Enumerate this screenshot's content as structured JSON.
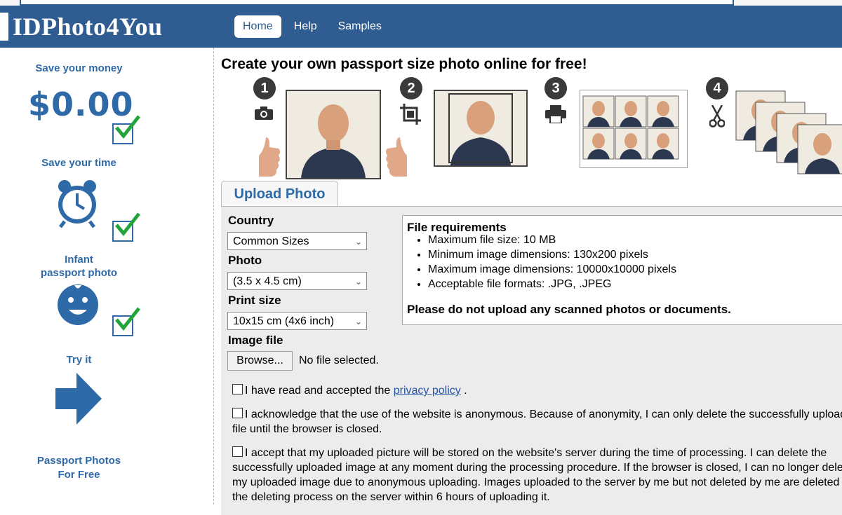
{
  "brand": {
    "logo": "IDPhoto4You"
  },
  "nav": {
    "items": [
      "Home",
      "Help",
      "Samples"
    ]
  },
  "sidebar": {
    "save_money": "Save your money",
    "price": "$0.00",
    "save_time": "Save your time",
    "infant": "Infant\npassport photo",
    "try_it": "Try it",
    "footer": "Passport Photos\nFor Free"
  },
  "main": {
    "headline": "Create your own passport size photo online for free!",
    "steps": [
      "1",
      "2",
      "3",
      "4"
    ],
    "tab": "Upload Photo"
  },
  "form": {
    "country_label": "Country",
    "country_value": "Common Sizes",
    "photo_label": "Photo",
    "photo_value": "(3.5 x 4.5 cm)",
    "print_label": "Print size",
    "print_value": "10x15 cm (4x6 inch)",
    "image_label": "Image file",
    "browse": "Browse...",
    "no_file": "No file selected."
  },
  "requirements": {
    "title": "File requirements",
    "items": [
      "Maximum file size: 10 MB",
      "Minimum image dimensions: 130x200 pixels",
      "Maximum image dimensions: 10000x10000 pixels",
      "Acceptable file formats: .JPG, .JPEG"
    ],
    "warning": "Please do not upload any scanned photos or documents."
  },
  "agreements": {
    "a1_pre": "I have read and accepted the ",
    "a1_link": "privacy policy",
    "a1_post": " .",
    "a2": "I acknowledge that the use of the website is anonymous. Because of anonymity, I can only delete the successfully uploaded file until the browser is closed.",
    "a3": "I accept that my uploaded picture will be stored on the website's server during the time of processing. I can delete the successfully uploaded image at any moment during the processing procedure. If the browser is closed, I can no longer delete my uploaded image due to anonymous uploading. Images uploaded to the server by me but not deleted by me are deleted by the deleting process on the server within 6 hours of uploading it."
  },
  "colors": {
    "brand": "#2f5d92",
    "accent": "#2e6aa8",
    "check": "#21a53a"
  }
}
